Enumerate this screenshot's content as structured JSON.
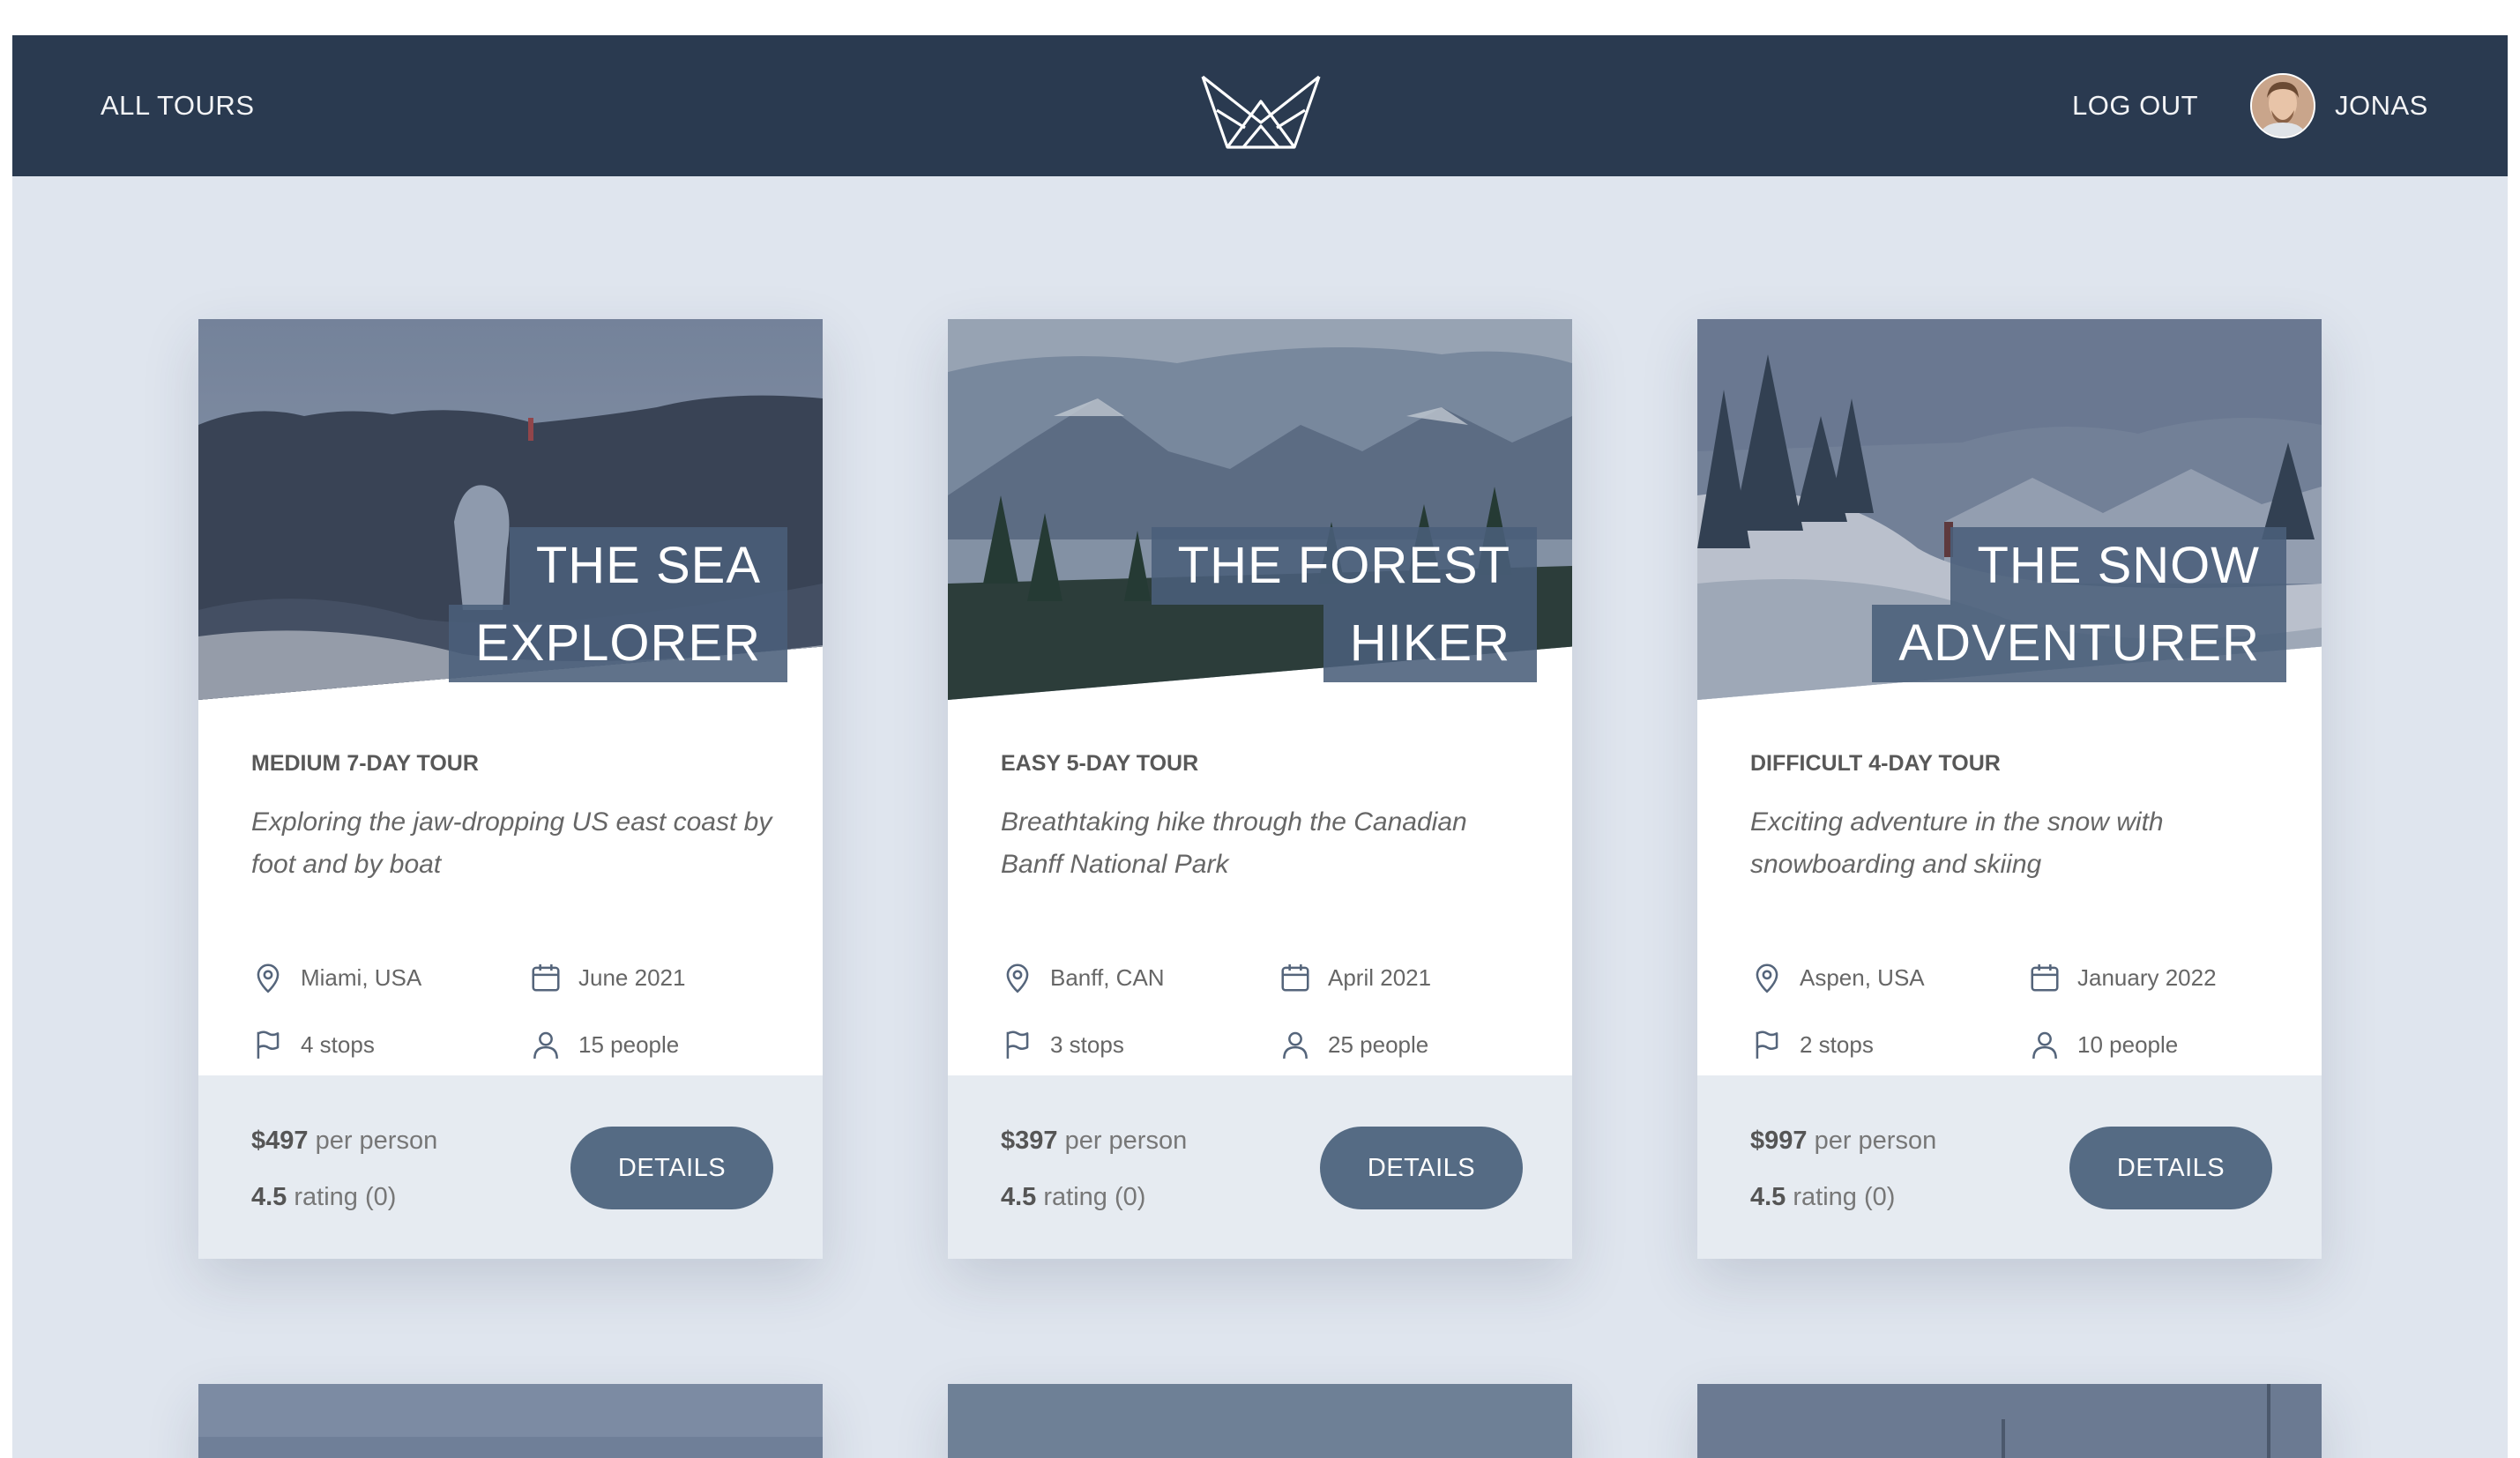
{
  "header": {
    "all_tours": "ALL TOURS",
    "logout": "LOG OUT",
    "user_name": "JONAS",
    "logo_icon": "crown-logo-icon"
  },
  "colors": {
    "header_bg": "#2a3a50",
    "page_bg": "#dfe5ee",
    "button_bg": "#556b84",
    "footer_bg": "#e6ebf1"
  },
  "tours": [
    {
      "title_line1": "THE SEA",
      "title_line2": "EXPLORER",
      "difficulty": "MEDIUM 7-DAY TOUR",
      "summary": "Exploring the jaw-dropping US east coast by foot and by boat",
      "location": "Miami, USA",
      "date": "June 2021",
      "stops": "4 stops",
      "people": "15 people",
      "price": "$497",
      "price_suffix": "per person",
      "rating": "4.5",
      "rating_suffix": "rating (0)",
      "button": "DETAILS"
    },
    {
      "title_line1": "THE FOREST",
      "title_line2": "HIKER",
      "difficulty": "EASY 5-DAY TOUR",
      "summary": "Breathtaking hike through the Canadian Banff National Park",
      "location": "Banff, CAN",
      "date": "April 2021",
      "stops": "3 stops",
      "people": "25 people",
      "price": "$397",
      "price_suffix": "per person",
      "rating": "4.5",
      "rating_suffix": "rating (0)",
      "button": "DETAILS"
    },
    {
      "title_line1": "THE SNOW",
      "title_line2": "ADVENTURER",
      "difficulty": "DIFFICULT 4-DAY TOUR",
      "summary": "Exciting adventure in the snow with snowboarding and skiing",
      "location": "Aspen, USA",
      "date": "January 2022",
      "stops": "2 stops",
      "people": "10 people",
      "price": "$997",
      "price_suffix": "per person",
      "rating": "4.5",
      "rating_suffix": "rating (0)",
      "button": "DETAILS"
    }
  ]
}
